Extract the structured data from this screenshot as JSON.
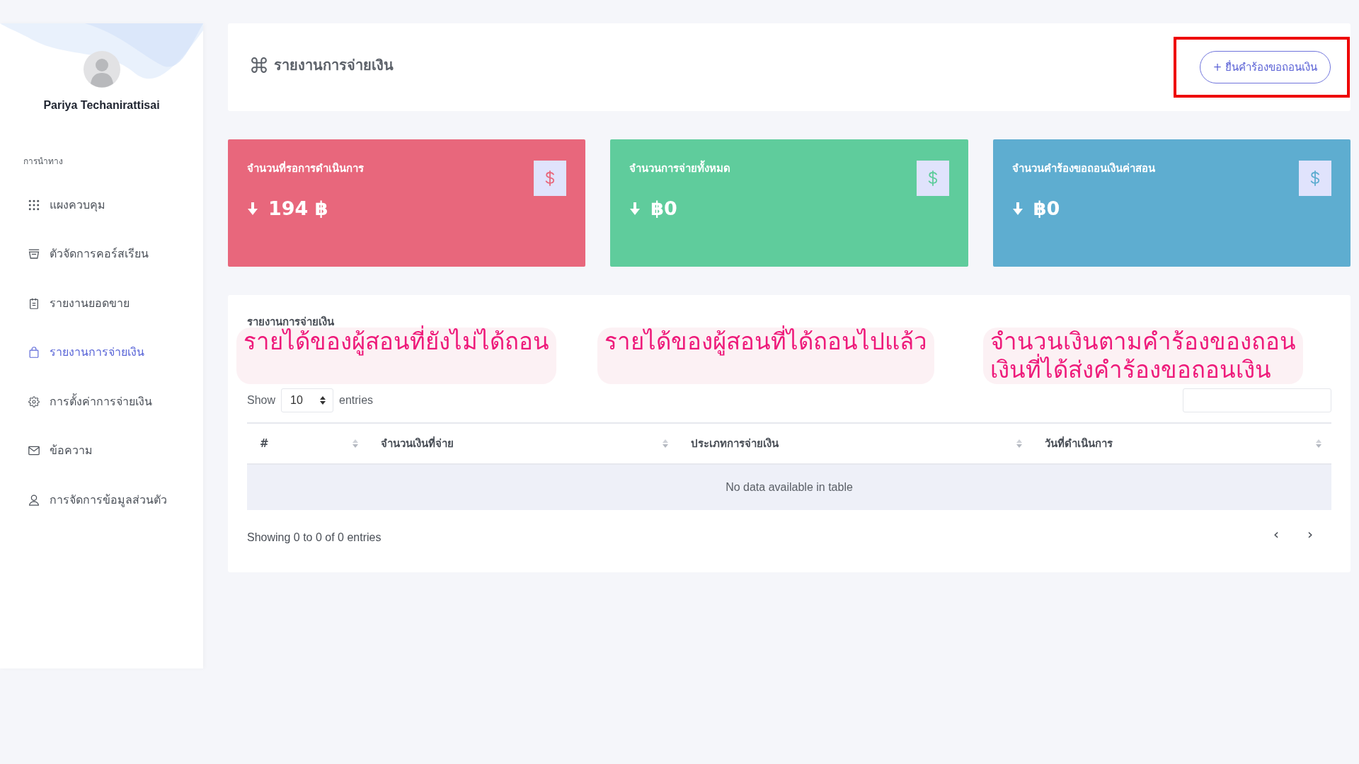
{
  "sidebar": {
    "user_name": "Pariya Techanirattisai",
    "section_label": "การนำทาง",
    "items": [
      {
        "label": "แผงควบคุม",
        "selected": false
      },
      {
        "label": "ตัวจัดการคอร์สเรียน",
        "selected": false
      },
      {
        "label": "รายงานยอดขาย",
        "selected": false
      },
      {
        "label": "รายงานการจ่ายเงิน",
        "selected": true
      },
      {
        "label": "การตั้งค่าการจ่ายเงิน",
        "selected": false
      },
      {
        "label": "ข้อความ",
        "selected": false
      },
      {
        "label": "การจัดการข้อมูลส่วนตัว",
        "selected": false
      }
    ]
  },
  "header": {
    "title": "รายงานการจ่ายเงิน",
    "button": {
      "label": "+ ยื่นคำร้องขอถอนเงิน",
      "highlighted": true
    }
  },
  "cards": [
    {
      "title": "จำนวนที่รอการดำเนินการ",
      "value": "194 ฿",
      "color": "#e8677c"
    },
    {
      "title": "จำนวนการจ่ายทั้งหมด",
      "value": "฿0",
      "color": "#5fcc9c"
    },
    {
      "title": "จำนวนคำร้องขอถอนเงินค่าสอน",
      "value": "฿0",
      "color": "#5eadd0"
    }
  ],
  "table": {
    "title": "รายงานการจ่ายเงิน",
    "length_label": "Show",
    "page_length": "10",
    "length_suffix": "entries",
    "columns": [
      "#",
      "จำนวนเงินที่จ่าย",
      "ประเภทการจ่ายเงิน",
      "วันที่ดำเนินการ"
    ],
    "empty_message": "No data available in table",
    "info": "Showing 0 to 0 of 0 entries",
    "pagination": {
      "previous": "‹",
      "next": "›"
    }
  },
  "annotations": [
    {
      "lines": [
        "รายได้ของผู้สอนที่ยังไม่ได้ถอน"
      ]
    },
    {
      "lines": [
        "รายได้ของผู้สอนที่ได้ถอนไปแล้ว"
      ]
    },
    {
      "lines": [
        "จำนวนเงินตามคำร้องของถอน",
        "เงินที่ได้ส่งคำร้องขอถอนเงิน"
      ]
    }
  ]
}
